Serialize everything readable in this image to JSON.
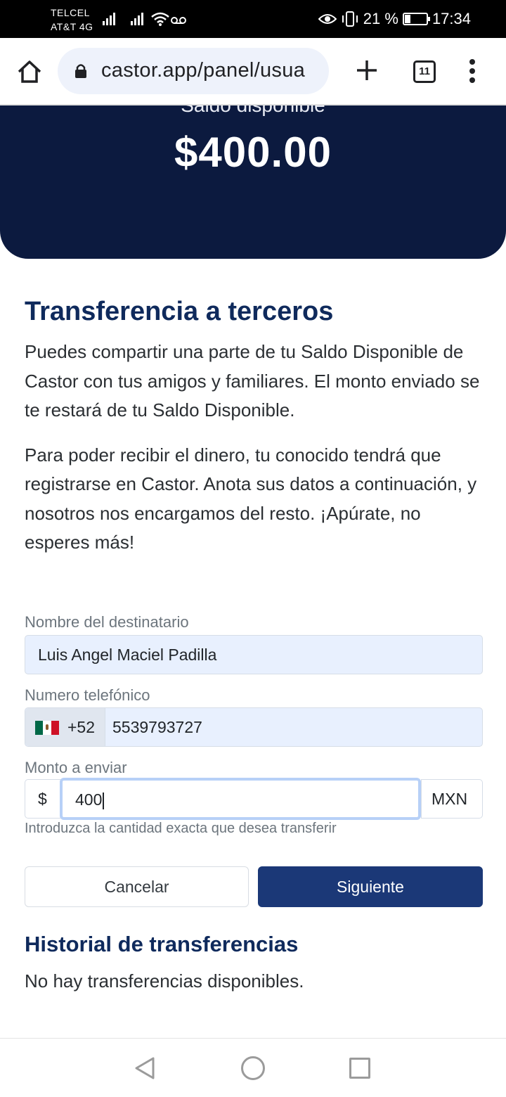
{
  "status_bar": {
    "carrier_1": "TELCEL",
    "carrier_2": "AT&T 4G",
    "battery_percent": "21 %",
    "time": "17:34"
  },
  "browser": {
    "url": "castor.app/panel/usua",
    "tab_count": "11"
  },
  "balance": {
    "label": "Saldo disponible",
    "amount": "$400.00"
  },
  "transfer": {
    "title": "Transferencia a terceros",
    "paragraph_1": "Puedes compartir una parte de tu Saldo Disponible de Castor con tus amigos y familiares. El monto enviado se te restará de tu Saldo Disponible.",
    "paragraph_2": "Para poder recibir el dinero, tu conocido tendrá que registrarse en Castor. Anota sus datos a continuación, y nosotros nos encargamos del resto. ¡Apúrate, no esperes más!",
    "recipient": {
      "label": "Nombre del destinatario",
      "value": "Luis Angel Maciel Padilla"
    },
    "phone": {
      "label": "Numero telefónico",
      "prefix": "+52",
      "value": "5539793727"
    },
    "amount": {
      "label": "Monto a enviar",
      "prefix": "$",
      "value": "400",
      "currency": "MXN",
      "help": "Introduzca la cantidad exacta que desea transferir"
    },
    "cancel_label": "Cancelar",
    "next_label": "Siguiente"
  },
  "history": {
    "title": "Historial de transferencias",
    "empty": "No hay transferencias disponibles."
  },
  "icons": {
    "home": "home-icon",
    "lock": "lock-icon",
    "new_tab": "plus-icon",
    "tabs": "tab-switcher-icon",
    "menu": "more-vert-icon",
    "flag": "mexico-flag-icon",
    "back": "back-triangle-icon",
    "nav_home": "home-circle-icon",
    "recents": "recents-square-icon"
  },
  "colors": {
    "header_bg": "#0c1a3f",
    "title": "#0f2a5c",
    "primary_button": "#1b3877"
  }
}
